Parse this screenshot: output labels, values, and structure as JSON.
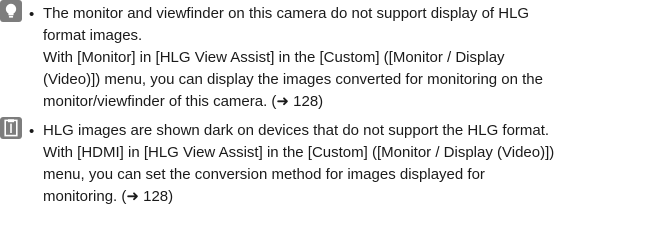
{
  "notes": [
    {
      "icon": "lightbulb-icon",
      "bullet": "•",
      "lines": [
        "The monitor and viewfinder on this camera do not support display of HLG",
        "format images.",
        "With [Monitor] in [HLG View Assist] in the [Custom] ([Monitor / Display",
        "(Video)]) menu, you can display the images converted for monitoring on the",
        "monitor/viewfinder of this camera. (➜ 128)"
      ]
    },
    {
      "icon": "memo-icon",
      "bullet": "•",
      "lines": [
        "HLG images are shown dark on devices that do not support the HLG format.",
        "With [HDMI] in [HLG View Assist] in the [Custom] ([Monitor / Display (Video)])",
        "menu, you can set the conversion method for images displayed for",
        "monitoring. (➜ 128)"
      ]
    }
  ],
  "colors": {
    "icon_background": "#7d7d7d",
    "text": "#1a1a1a"
  }
}
